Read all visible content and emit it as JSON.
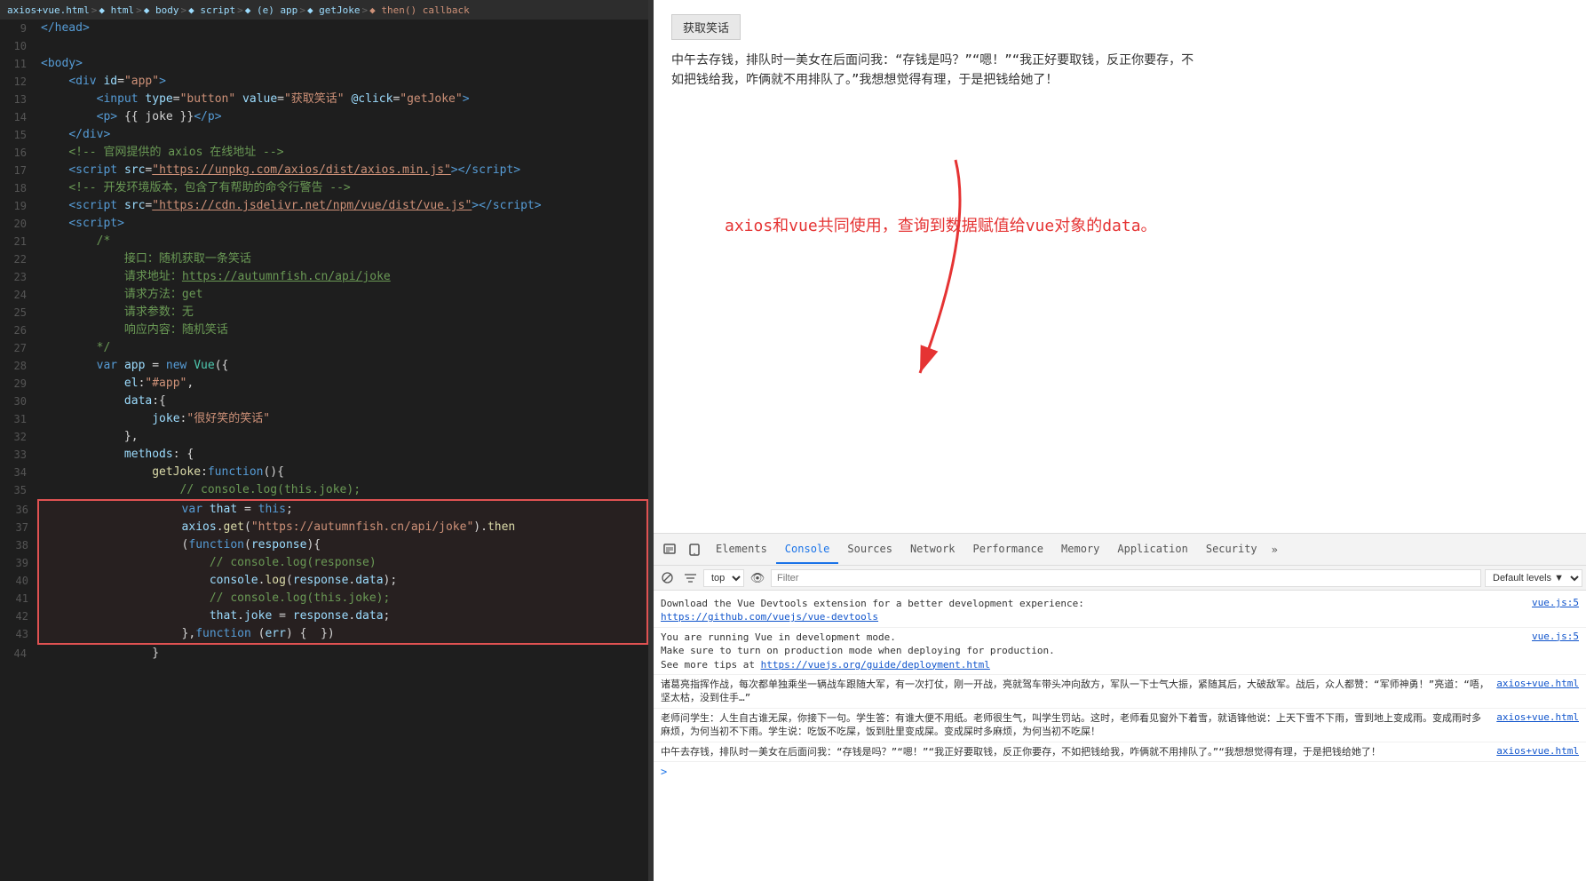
{
  "breadcrumb": {
    "items": [
      {
        "label": "axios+vue.html",
        "type": "file"
      },
      {
        "label": "html",
        "type": "tag"
      },
      {
        "label": "body",
        "type": "tag"
      },
      {
        "label": "script",
        "type": "tag"
      },
      {
        "label": "(e) app",
        "type": "obj"
      },
      {
        "label": "getJoke",
        "type": "func"
      },
      {
        "label": "then() callback",
        "type": "func"
      }
    ]
  },
  "code": {
    "lines": [
      {
        "num": 9,
        "html": "<span class='t-tag'>&lt;/head&gt;</span>"
      },
      {
        "num": 10,
        "html": ""
      },
      {
        "num": 11,
        "html": "<span class='t-tag'>&lt;body&gt;</span>"
      },
      {
        "num": 12,
        "html": "    <span class='t-tag'>&lt;div</span> <span class='t-attr'>id</span>=<span class='t-val'>\"app\"</span><span class='t-tag'>&gt;</span>"
      },
      {
        "num": 13,
        "html": "        <span class='t-tag'>&lt;input</span> <span class='t-attr'>type</span>=<span class='t-val'>\"button\"</span> <span class='t-attr'>value</span>=<span class='t-val'>\"获取笑话\"</span> <span class='t-attr'>@click</span>=<span class='t-val'>\"getJoke\"</span><span class='t-tag'>&gt;</span>"
      },
      {
        "num": 14,
        "html": "        <span class='t-tag'>&lt;p&gt;</span> <span class='t-white'>{{ joke }}</span><span class='t-tag'>&lt;/p&gt;</span>"
      },
      {
        "num": 15,
        "html": "    <span class='t-tag'>&lt;/div&gt;</span>"
      },
      {
        "num": 16,
        "html": "    <span class='t-comment'>&lt;!-- 官网提供的 axios 在线地址 --&gt;</span>"
      },
      {
        "num": 17,
        "html": "    <span class='t-tag'>&lt;script</span> <span class='t-attr'>src</span>=<span class='t-underline'>\"https://unpkg.com/axios/dist/axios.min.js\"</span><span class='t-tag'>&gt;&lt;/script&gt;</span>"
      },
      {
        "num": 18,
        "html": "    <span class='t-comment'>&lt;!-- 开发环境版本，包含了有帮助的命令行警告 --&gt;</span>"
      },
      {
        "num": 19,
        "html": "    <span class='t-tag'>&lt;script</span> <span class='t-attr'>src</span>=<span class='t-underline'>\"https://cdn.jsdelivr.net/npm/vue/dist/vue.js\"</span><span class='t-tag'>&gt;&lt;/script&gt;</span>"
      },
      {
        "num": 20,
        "html": "    <span class='t-tag'>&lt;script&gt;</span>"
      },
      {
        "num": 21,
        "html": "        <span class='t-comment'>/*</span>"
      },
      {
        "num": 22,
        "html": "            <span class='t-comment'>接口：随机获取一条笑话</span>"
      },
      {
        "num": 23,
        "html": "            <span class='t-comment'>请求地址：<span style='text-decoration:underline'>https://autumnfish.cn/api/joke</span></span>"
      },
      {
        "num": 24,
        "html": "            <span class='t-comment'>请求方法：get</span>"
      },
      {
        "num": 25,
        "html": "            <span class='t-comment'>请求参数：无</span>"
      },
      {
        "num": 26,
        "html": "            <span class='t-comment'>响应内容：随机笑话</span>"
      },
      {
        "num": 27,
        "html": ""
      },
      {
        "num": 28,
        "html": "        <span class='t-keyword'>var</span> <span class='t-var'>app</span> <span class='t-op'>=</span> <span class='t-keyword'>new</span> <span class='t-cyan'>Vue</span><span class='t-punct'>({</span>"
      },
      {
        "num": 29,
        "html": "            <span class='t-prop'>el</span><span class='t-punct'>:</span><span class='t-string'>\"#app\"</span><span class='t-punct'>,</span>"
      },
      {
        "num": 30,
        "html": "            <span class='t-prop'>data</span><span class='t-punct'>:{</span>"
      },
      {
        "num": 31,
        "html": "                <span class='t-prop'>joke</span><span class='t-punct'>:</span><span class='t-string'>\"很好笑的笑话\"</span>"
      },
      {
        "num": 32,
        "html": "            <span class='t-punct'>},</span>"
      },
      {
        "num": 33,
        "html": "            <span class='t-prop'>methods</span><span class='t-punct'>: {</span>"
      },
      {
        "num": 34,
        "html": "                <span class='t-func'>getJoke</span><span class='t-punct'>:</span><span class='t-keyword'>function</span><span class='t-punct'>(){</span>"
      },
      {
        "num": 35,
        "html": "                    <span class='t-comment'>// console.log(this.joke);</span>"
      },
      {
        "num": 36,
        "html": "                    <span class='t-keyword'>var</span> <span class='t-var'>that</span> <span class='t-op'>=</span> <span class='t-keyword'>this</span><span class='t-punct'>;</span>",
        "highlighted": true
      },
      {
        "num": 37,
        "html": "                    <span class='t-var'>axios</span><span class='t-punct'>.</span><span class='t-func'>get</span><span class='t-punct'>(</span><span class='t-string'>\"https://autumnfish.cn/api/joke\"</span><span class='t-punct'>).</span><span class='t-func'>then</span>",
        "highlighted": true
      },
      {
        "num": 38,
        "html": "                    <span class='t-punct'>(</span><span class='t-keyword'>function</span><span class='t-punct'>(</span><span class='t-var'>response</span><span class='t-punct'>){</span>",
        "highlighted": true
      },
      {
        "num": 39,
        "html": "                        <span class='t-comment'>// console.log(response)</span>",
        "highlighted": true
      },
      {
        "num": 40,
        "html": "                        <span class='t-var'>console</span><span class='t-punct'>.</span><span class='t-func'>log</span><span class='t-punct'>(</span><span class='t-var'>response</span><span class='t-punct'>.</span><span class='t-prop'>data</span><span class='t-punct'>);</span>",
        "highlighted": true
      },
      {
        "num": 41,
        "html": "                        <span class='t-comment'>// console.log(this.joke);</span>",
        "highlighted": true
      },
      {
        "num": 42,
        "html": "                        <span class='t-var'>that</span><span class='t-punct'>.</span><span class='t-prop'>joke</span> <span class='t-op'>=</span> <span class='t-var'>response</span><span class='t-punct'>.</span><span class='t-prop'>data</span><span class='t-punct'>;</span>",
        "highlighted": true
      },
      {
        "num": 43,
        "html": "                    <span class='t-punct'>},</span><span class='t-keyword'>function</span> <span class='t-punct'>(</span><span class='t-var'>err</span><span class='t-punct'>) {  })</span>",
        "highlighted": true
      },
      {
        "num": 44,
        "html": "                <span class='t-punct'>}</span>"
      }
    ]
  },
  "browser": {
    "button_label": "获取笑话",
    "joke_text": "中午去存钱，排队时一美女在后面问我：“存钱是吗？”“嗯！”“我正好要取钱，反正你要存，不如把钱给我，咋俩就不用排队了。”我想想觉得有理，于是把钱给她了！",
    "annotation": "axios和vue共同使用，查询到数据赋值给vue对象的data。"
  },
  "devtools": {
    "tabs": [
      {
        "label": "Elements",
        "active": false
      },
      {
        "label": "Console",
        "active": true
      },
      {
        "label": "Sources",
        "active": false
      },
      {
        "label": "Network",
        "active": false
      },
      {
        "label": "Performance",
        "active": false
      },
      {
        "label": "Memory",
        "active": false
      },
      {
        "label": "Application",
        "active": false
      },
      {
        "label": "Security",
        "active": false
      }
    ],
    "toolbar": {
      "console_value": "top",
      "filter_placeholder": "Filter",
      "levels_label": "Default levels ▼"
    },
    "console_entries": [
      {
        "text": "Download the Vue Devtools extension for a better development experience:\nhttps://github.com/vuejs/vue-devtools",
        "source": "vue.js:5"
      },
      {
        "text": "You are running Vue in development mode.\nMake sure to turn on production mode when deploying for production.\nSee more tips at https://vuejs.org/guide/deployment.html",
        "source": "vue.js:5"
      },
      {
        "text": "诸葛亮指挥作战，每次都单独乘坐一辆战车跟随大军，有一次打仗，刚一开战，亮就驾车带头冲向敌方，军队一下士气大振，紧随其后，大破敌军。战后，众人都赞：“军师神勇！”亮道：“唔，坚太枯，没到住手…”",
        "source": "axios+vue.html"
      },
      {
        "text": "老师问学生：人生自古谁无屎，你接下一句。学生答：有谁大便不用纸。老师很生气，叫学生罚站。这时，老师看见窗外下着雪，就语锋他说：上天下雪不下雨，雪到地上变成雨。变成雨时多麻烦，为何当初不下雨。学生说：吃饭不吃屎，饭到肚里变成屎。变成屎时多麻烦，为何当初不吃屎！",
        "source": "axios+vue.html"
      },
      {
        "text": "中午去存钱，排队时一美女在后面问我：“存钱是吗？”“嗯！”“我正好要取钱，反正你要存，不如把钱给我，咋俩就不用排队了。”“我想想觉得有理，于是把钱给她了！",
        "source": "axios+vue.html"
      }
    ],
    "prompt_indicator": ">"
  }
}
